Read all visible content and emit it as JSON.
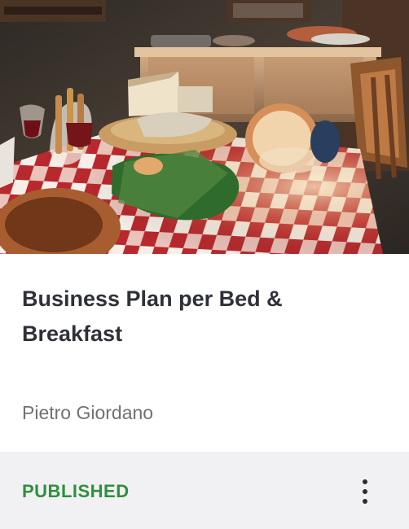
{
  "card": {
    "title": "Business Plan per Bed & Breakfast",
    "author": "Pietro Giordano",
    "status": "PUBLISHED",
    "more_icon": "vertical-ellipsis-icon",
    "colors": {
      "status": "#2e8f3d",
      "title": "#2f3138",
      "author": "#6f7176",
      "footer_background": "#f1f1f3"
    }
  }
}
